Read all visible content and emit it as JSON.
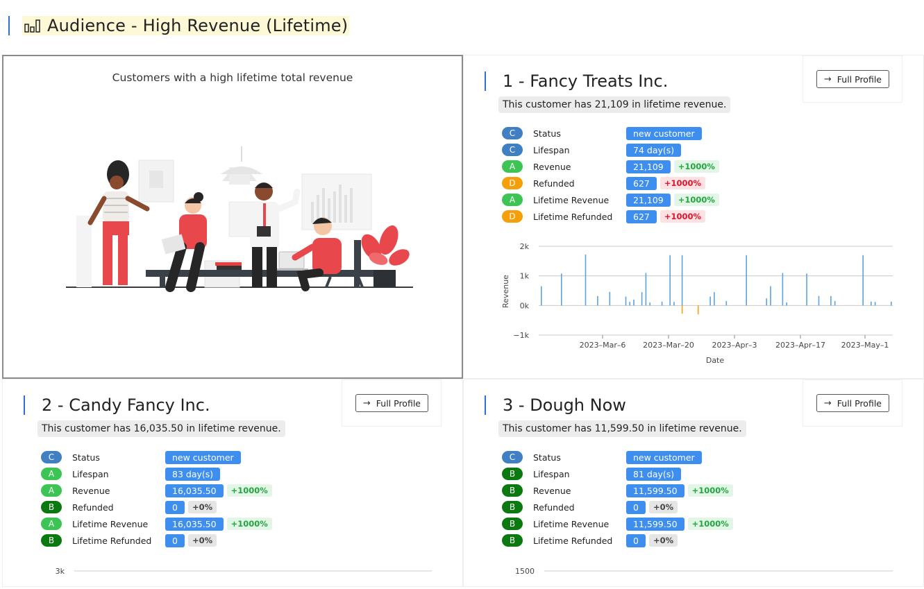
{
  "page": {
    "title": "Audience - High Revenue (Lifetime)",
    "title_icon": "bar-chart-icon"
  },
  "intro": {
    "text": "Customers with a high lifetime total revenue"
  },
  "colors": {
    "accent": "#2f6fce",
    "value_bg": "#3e8ef0",
    "grade_A": "#3cc454",
    "grade_B": "#0a7a10",
    "grade_C": "#3f7fc2",
    "grade_D": "#f5a00b",
    "pos_text": "#1ea83e",
    "neg_text": "#e0142b"
  },
  "customers": [
    {
      "title": "1 - Fancy Treats Inc.",
      "button": "Full Profile",
      "summary": "This customer has 21,109 in lifetime revenue.",
      "metrics": [
        {
          "grade": "C",
          "label": "Status",
          "value": "new customer",
          "change": ""
        },
        {
          "grade": "C",
          "label": "Lifespan",
          "value": "74 day(s)",
          "change": ""
        },
        {
          "grade": "A",
          "label": "Revenue",
          "value": "21,109",
          "change": "+1000%"
        },
        {
          "grade": "D",
          "label": "Refunded",
          "value": "627",
          "change": "+1000%"
        },
        {
          "grade": "A",
          "label": "Lifetime Revenue",
          "value": "21,109",
          "change": "+1000%"
        },
        {
          "grade": "D",
          "label": "Lifetime Refunded",
          "value": "627",
          "change": "+1000%"
        }
      ],
      "chart_data": {
        "type": "bar",
        "xlabel": "Date",
        "ylabel": "Revenue",
        "ylim": [
          -1000,
          2000
        ],
        "yticks": [
          "2k",
          "1k",
          "0k",
          "−1k"
        ],
        "xticks": [
          "2023–Mar–6",
          "2023–Mar–20",
          "2023–Apr–3",
          "2023–Apr–17",
          "2023–May–1"
        ],
        "grid": true,
        "series": [
          {
            "values": [
              650,
              0,
              0,
              0,
              0,
              1080,
              0,
              0,
              0,
              0,
              0,
              1720,
              0,
              0,
              320,
              0,
              0,
              460,
              0,
              0,
              0,
              300,
              120,
              200,
              0,
              450,
              1100,
              100,
              0,
              0,
              130,
              0,
              1700,
              120,
              0,
              1700,
              0,
              0,
              0,
              0,
              0,
              0,
              300,
              450,
              0,
              0,
              150,
              0,
              0,
              0,
              0,
              1700,
              0,
              0,
              0,
              0,
              240,
              650,
              0,
              0,
              1100,
              100,
              0,
              0,
              0,
              0,
              1080,
              0,
              0,
              320,
              0,
              0,
              320,
              150,
              0,
              0,
              0,
              0,
              0,
              0,
              1700,
              0,
              130,
              120,
              0,
              0,
              0,
              130
            ]
          },
          {
            "values": [
              0,
              0,
              0,
              0,
              0,
              0,
              0,
              0,
              0,
              0,
              0,
              0,
              0,
              0,
              0,
              0,
              0,
              0,
              0,
              0,
              0,
              0,
              0,
              0,
              0,
              0,
              0,
              0,
              0,
              0,
              0,
              0,
              0,
              0,
              0,
              -280,
              0,
              0,
              0,
              -300,
              0,
              0,
              0,
              0,
              0,
              0,
              0,
              0,
              0,
              0,
              0,
              0,
              0,
              0,
              0,
              0,
              0,
              0,
              0,
              0,
              0,
              0,
              0,
              0,
              0,
              0,
              0,
              0,
              0,
              0,
              0,
              0,
              0,
              0,
              0,
              0,
              0,
              0,
              0,
              0,
              0,
              0,
              0,
              0,
              0,
              0,
              0,
              0
            ]
          }
        ]
      }
    },
    {
      "title": "2 - Candy Fancy Inc.",
      "button": "Full Profile",
      "summary": "This customer has 16,035.50 in lifetime revenue.",
      "metrics": [
        {
          "grade": "C",
          "label": "Status",
          "value": "new customer",
          "change": ""
        },
        {
          "grade": "A",
          "label": "Lifespan",
          "value": "83 day(s)",
          "change": ""
        },
        {
          "grade": "A",
          "label": "Revenue",
          "value": "16,035.50",
          "change": "+1000%"
        },
        {
          "grade": "B",
          "label": "Refunded",
          "value": "0",
          "change": "+0%"
        },
        {
          "grade": "A",
          "label": "Lifetime Revenue",
          "value": "16,035.50",
          "change": "+1000%"
        },
        {
          "grade": "B",
          "label": "Lifetime Refunded",
          "value": "0",
          "change": "+0%"
        }
      ],
      "chart_top_tick": "3k"
    },
    {
      "title": "3 - Dough Now",
      "button": "Full Profile",
      "summary": "This customer has 11,599.50 in lifetime revenue.",
      "metrics": [
        {
          "grade": "C",
          "label": "Status",
          "value": "new customer",
          "change": ""
        },
        {
          "grade": "B",
          "label": "Lifespan",
          "value": "81 day(s)",
          "change": ""
        },
        {
          "grade": "B",
          "label": "Revenue",
          "value": "11,599.50",
          "change": "+1000%"
        },
        {
          "grade": "B",
          "label": "Refunded",
          "value": "0",
          "change": "+0%"
        },
        {
          "grade": "B",
          "label": "Lifetime Revenue",
          "value": "11,599.50",
          "change": "+1000%"
        },
        {
          "grade": "B",
          "label": "Lifetime Refunded",
          "value": "0",
          "change": "+0%"
        }
      ],
      "chart_top_tick": "1500"
    }
  ]
}
